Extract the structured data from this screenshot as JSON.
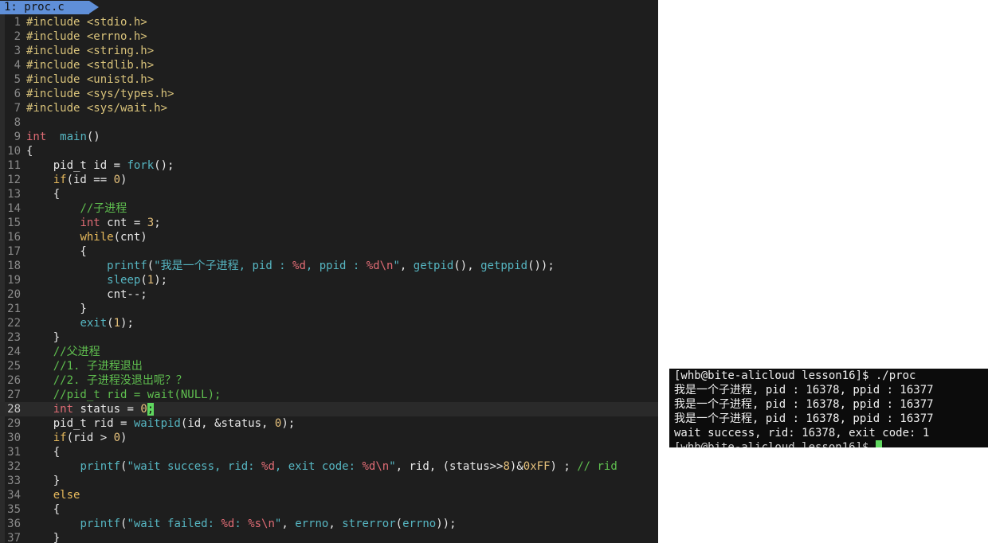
{
  "editor": {
    "tab_label": "1: proc.c",
    "current_line": 28
  },
  "terminal": {
    "prompt_line": "[whb@bite-alicloud lesson16]$ ./proc",
    "output": [
      "我是一个子进程, pid : 16378, ppid : 16377",
      "我是一个子进程, pid : 16378, ppid : 16377",
      "我是一个子进程, pid : 16378, ppid : 16377",
      "wait success, rid: 16378, exit code: 1"
    ],
    "partial_line": "[whb@bite-alicloud lesson16]$ "
  },
  "code_lines": [
    {
      "n": "1",
      "segs": [
        [
          "pp",
          "#include "
        ],
        [
          "pp",
          "<stdio.h>"
        ]
      ]
    },
    {
      "n": "2",
      "segs": [
        [
          "pp",
          "#include "
        ],
        [
          "pp",
          "<errno.h>"
        ]
      ]
    },
    {
      "n": "3",
      "segs": [
        [
          "pp",
          "#include "
        ],
        [
          "pp",
          "<string.h>"
        ]
      ]
    },
    {
      "n": "4",
      "segs": [
        [
          "pp",
          "#include "
        ],
        [
          "pp",
          "<stdlib.h>"
        ]
      ]
    },
    {
      "n": "5",
      "segs": [
        [
          "pp",
          "#include "
        ],
        [
          "pp",
          "<unistd.h>"
        ]
      ]
    },
    {
      "n": "6",
      "segs": [
        [
          "pp",
          "#include "
        ],
        [
          "pp",
          "<sys/types.h>"
        ]
      ]
    },
    {
      "n": "7",
      "segs": [
        [
          "pp",
          "#include "
        ],
        [
          "pp",
          "<sys/wait.h>"
        ]
      ]
    },
    {
      "n": "8",
      "segs": []
    },
    {
      "n": "9",
      "segs": [
        [
          "ty",
          "int"
        ],
        [
          "",
          "  "
        ],
        [
          "fn",
          "main"
        ],
        [
          "",
          "()"
        ]
      ]
    },
    {
      "n": "10",
      "segs": [
        [
          "",
          "{"
        ]
      ]
    },
    {
      "n": "11",
      "segs": [
        [
          "",
          "    pid_t id = "
        ],
        [
          "fn",
          "fork"
        ],
        [
          "",
          "();"
        ]
      ]
    },
    {
      "n": "12",
      "segs": [
        [
          "",
          "    "
        ],
        [
          "kw",
          "if"
        ],
        [
          "",
          "(id == "
        ],
        [
          "num",
          "0"
        ],
        [
          "",
          ")"
        ]
      ]
    },
    {
      "n": "13",
      "segs": [
        [
          "",
          "    {"
        ]
      ]
    },
    {
      "n": "14",
      "segs": [
        [
          "",
          "        "
        ],
        [
          "cm",
          "//子进程"
        ]
      ]
    },
    {
      "n": "15",
      "segs": [
        [
          "",
          "        "
        ],
        [
          "ty",
          "int"
        ],
        [
          "",
          " cnt = "
        ],
        [
          "num",
          "3"
        ],
        [
          "",
          ";"
        ]
      ]
    },
    {
      "n": "16",
      "segs": [
        [
          "",
          "        "
        ],
        [
          "kw",
          "while"
        ],
        [
          "",
          "(cnt)"
        ]
      ]
    },
    {
      "n": "17",
      "segs": [
        [
          "",
          "        {"
        ]
      ]
    },
    {
      "n": "18",
      "segs": [
        [
          "",
          "            "
        ],
        [
          "fn",
          "printf"
        ],
        [
          "",
          "("
        ],
        [
          "str",
          "\"我是一个子进程, pid : "
        ],
        [
          "fmt",
          "%d"
        ],
        [
          "str",
          ", ppid : "
        ],
        [
          "fmt",
          "%d\\n"
        ],
        [
          "str",
          "\""
        ],
        [
          "",
          ", "
        ],
        [
          "fn",
          "getpid"
        ],
        [
          "",
          "(), "
        ],
        [
          "fn",
          "getppid"
        ],
        [
          "",
          "());"
        ]
      ]
    },
    {
      "n": "19",
      "segs": [
        [
          "",
          "            "
        ],
        [
          "fn",
          "sleep"
        ],
        [
          "",
          "("
        ],
        [
          "num",
          "1"
        ],
        [
          "",
          ");"
        ]
      ]
    },
    {
      "n": "20",
      "segs": [
        [
          "",
          "            cnt--;"
        ]
      ]
    },
    {
      "n": "21",
      "segs": [
        [
          "",
          "        }"
        ]
      ]
    },
    {
      "n": "22",
      "segs": [
        [
          "",
          "        "
        ],
        [
          "fn",
          "exit"
        ],
        [
          "",
          "("
        ],
        [
          "num",
          "1"
        ],
        [
          "",
          ");"
        ]
      ]
    },
    {
      "n": "23",
      "segs": [
        [
          "",
          "    }"
        ]
      ]
    },
    {
      "n": "24",
      "segs": [
        [
          "",
          "    "
        ],
        [
          "cm",
          "//父进程"
        ]
      ]
    },
    {
      "n": "25",
      "segs": [
        [
          "",
          "    "
        ],
        [
          "cm",
          "//1. 子进程退出"
        ]
      ]
    },
    {
      "n": "26",
      "segs": [
        [
          "",
          "    "
        ],
        [
          "cm",
          "//2. 子进程没退出呢？？"
        ]
      ]
    },
    {
      "n": "27",
      "segs": [
        [
          "",
          "    "
        ],
        [
          "cm",
          "//pid_t rid = wait(NULL);"
        ]
      ]
    },
    {
      "n": "28",
      "segs": [
        [
          "",
          "    "
        ],
        [
          "ty",
          "int"
        ],
        [
          "",
          " status = "
        ],
        [
          "num",
          "0"
        ],
        [
          "cursor",
          ";"
        ]
      ]
    },
    {
      "n": "29",
      "segs": [
        [
          "",
          "    pid_t rid = "
        ],
        [
          "fn",
          "waitpid"
        ],
        [
          "",
          "(id, &status, "
        ],
        [
          "num",
          "0"
        ],
        [
          "",
          ");"
        ]
      ]
    },
    {
      "n": "30",
      "segs": [
        [
          "",
          "    "
        ],
        [
          "kw",
          "if"
        ],
        [
          "",
          "(rid > "
        ],
        [
          "num",
          "0"
        ],
        [
          "",
          ")"
        ]
      ]
    },
    {
      "n": "31",
      "segs": [
        [
          "",
          "    {"
        ]
      ]
    },
    {
      "n": "32",
      "segs": [
        [
          "",
          "        "
        ],
        [
          "fn",
          "printf"
        ],
        [
          "",
          "("
        ],
        [
          "str",
          "\"wait success, rid: "
        ],
        [
          "fmt",
          "%d"
        ],
        [
          "str",
          ", exit code: "
        ],
        [
          "fmt",
          "%d\\n"
        ],
        [
          "str",
          "\""
        ],
        [
          "",
          ", rid, (status>>"
        ],
        [
          "num",
          "8"
        ],
        [
          "",
          ")&"
        ],
        [
          "num",
          "0xFF"
        ],
        [
          "",
          ") ; "
        ],
        [
          "cm",
          "// rid"
        ]
      ]
    },
    {
      "n": "33",
      "segs": [
        [
          "",
          "    }"
        ]
      ]
    },
    {
      "n": "34",
      "segs": [
        [
          "",
          "    "
        ],
        [
          "kw",
          "else"
        ]
      ]
    },
    {
      "n": "35",
      "segs": [
        [
          "",
          "    {"
        ]
      ]
    },
    {
      "n": "36",
      "segs": [
        [
          "",
          "        "
        ],
        [
          "fn",
          "printf"
        ],
        [
          "",
          "("
        ],
        [
          "str",
          "\"wait failed: "
        ],
        [
          "fmt",
          "%d"
        ],
        [
          "str",
          ": "
        ],
        [
          "fmt",
          "%s\\n"
        ],
        [
          "str",
          "\""
        ],
        [
          "",
          ", "
        ],
        [
          "fn",
          "errno"
        ],
        [
          "",
          ", "
        ],
        [
          "fn",
          "strerror"
        ],
        [
          "",
          "("
        ],
        [
          "fn",
          "errno"
        ],
        [
          "",
          "));"
        ]
      ]
    },
    {
      "n": "37",
      "segs": [
        [
          "",
          "    }"
        ]
      ]
    }
  ]
}
